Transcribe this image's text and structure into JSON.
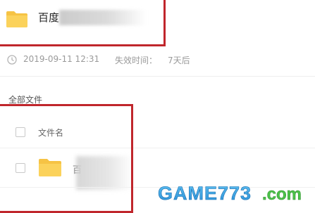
{
  "share": {
    "folder_name": "百度",
    "date": "2019-09-11 12:31",
    "expiry_label": "失效时间：",
    "expiry_value": "7天后"
  },
  "list": {
    "section_label": "全部文件",
    "column_filename": "文件名",
    "rows": [
      {
        "name": "百"
      }
    ]
  },
  "colors": {
    "folder": "#f7c843",
    "highlight_border": "#c0262c"
  },
  "watermark": {
    "text": "GAME773.com"
  }
}
